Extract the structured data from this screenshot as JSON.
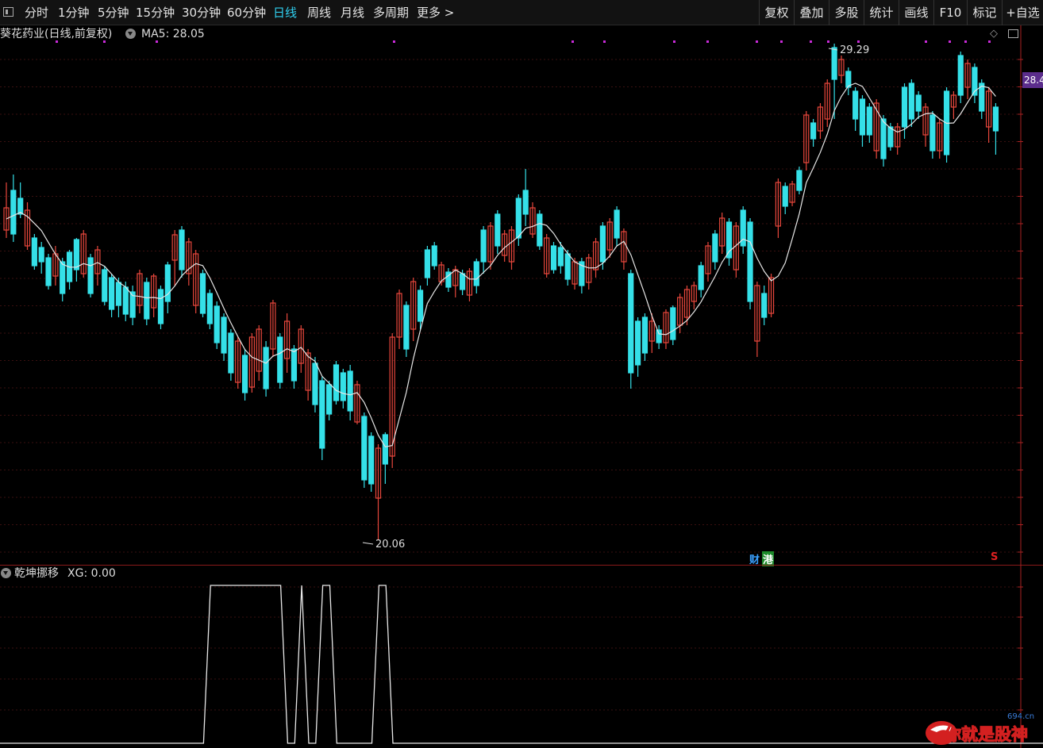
{
  "toolbar": {
    "periods": [
      "分时",
      "1分钟",
      "5分钟",
      "15分钟",
      "30分钟",
      "60分钟",
      "日线",
      "周线",
      "月线",
      "多周期",
      "更多 >"
    ],
    "active_period": "日线",
    "tools": [
      "复权",
      "叠加",
      "多股",
      "统计",
      "画线",
      "F10",
      "标记",
      "+自选"
    ]
  },
  "main_chart": {
    "stock_title": "葵花药业(日线,前复权)",
    "ma_label": "MA5: 28.05",
    "high_label": "29.29",
    "low_label": "20.06",
    "price_tag": "28.4",
    "up_color": "#e8473c",
    "down_color": "#35e0e8",
    "ma_color": "#e6e6e6",
    "marker_color": "#c82ad8"
  },
  "event_badges": {
    "cai": "财",
    "gang": "港",
    "s": "S"
  },
  "indicator": {
    "name": "乾坤挪移",
    "value_label": "XG: 0.00",
    "signal_values": [
      0,
      0,
      0,
      0,
      0,
      0,
      0,
      0,
      0,
      0,
      0,
      0,
      0,
      0,
      0,
      0,
      0,
      0,
      0,
      0,
      0,
      0,
      0,
      0,
      0,
      0,
      0,
      0,
      0,
      0,
      1,
      1,
      1,
      1,
      1,
      1,
      1,
      1,
      1,
      1,
      1,
      0,
      0,
      1,
      0,
      0,
      1,
      1,
      0,
      0,
      0,
      0,
      0,
      0,
      1,
      1,
      0,
      0,
      0,
      0,
      0,
      0,
      0,
      0,
      0,
      0,
      0,
      0,
      0,
      0,
      0,
      0,
      0,
      0,
      0,
      0,
      0,
      0,
      0,
      0,
      0,
      0,
      0,
      0,
      0,
      0,
      0,
      0,
      0,
      0,
      0,
      0,
      0,
      0,
      0,
      0,
      0,
      0,
      0,
      0,
      0,
      0,
      0,
      0,
      0,
      0,
      0,
      0,
      0,
      0,
      0,
      0,
      0,
      0,
      0,
      0,
      0,
      0,
      0,
      0,
      0,
      0,
      0,
      0,
      0,
      0,
      0,
      0,
      0,
      0,
      0,
      0,
      0,
      0,
      0,
      0,
      0,
      0,
      0,
      0,
      0,
      0,
      0,
      0,
      0,
      0,
      0,
      0,
      0,
      0
    ]
  },
  "watermark": {
    "text": "你就是股神",
    "site": "694.cn"
  }
}
